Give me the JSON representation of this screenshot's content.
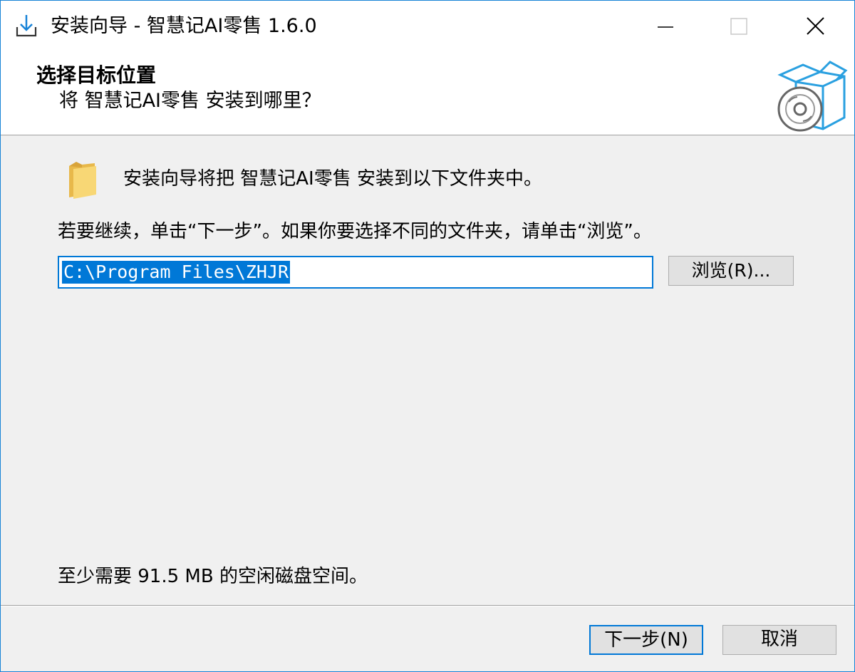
{
  "window": {
    "title": "安装向导 - 智慧记AI零售 1.6.0",
    "accent_color": "#0078d7"
  },
  "icons": {
    "app": "install-download-icon",
    "header": "package-disc-icon",
    "folder": "folder-icon",
    "minimize": "minimize-icon",
    "maximize": "maximize-icon",
    "close": "close-icon"
  },
  "header": {
    "title": "选择目标位置",
    "subtitle": "将 智慧记AI零售 安装到哪里？"
  },
  "body": {
    "intro": "安装向导将把 智慧记AI零售 安装到以下文件夹中。",
    "instruction": "若要继续，单击“下一步”。如果你要选择不同的文件夹，请单击“浏览”。",
    "install_path": "C:\\Program Files\\ZHJR",
    "browse_label": "浏览(R)...",
    "disk_space": "至少需要 91.5 MB 的空闲磁盘空间。"
  },
  "footer": {
    "next_label": "下一步(N)",
    "cancel_label": "取消"
  }
}
